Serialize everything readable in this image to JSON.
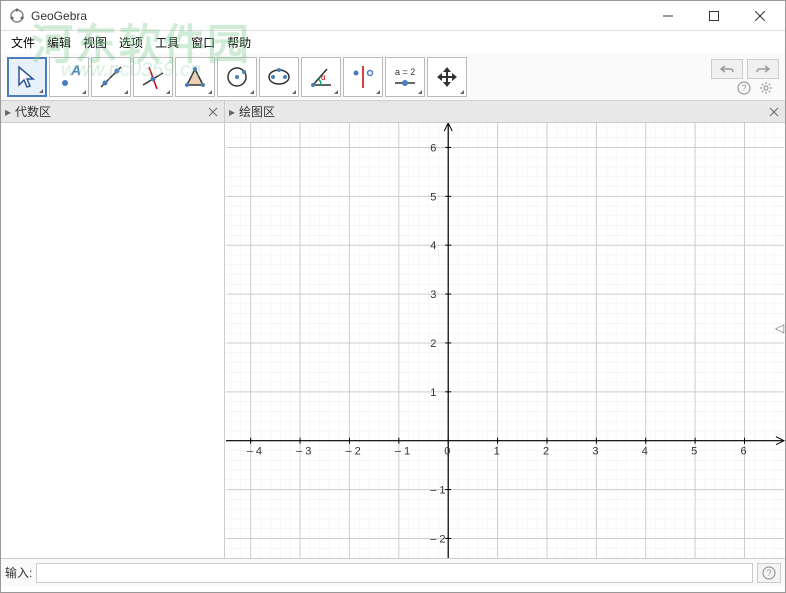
{
  "window": {
    "title": "GeoGebra",
    "min_tip": "—",
    "max_tip": "□",
    "close_tip": "✕"
  },
  "menu": {
    "items": [
      "文件",
      "编辑",
      "视图",
      "选项",
      "工具",
      "窗口",
      "帮助"
    ]
  },
  "toolbar": {
    "tools": [
      {
        "name": "move",
        "selected": true
      },
      {
        "name": "point",
        "selected": false
      },
      {
        "name": "line",
        "selected": false
      },
      {
        "name": "perpendicular",
        "selected": false
      },
      {
        "name": "polygon",
        "selected": false
      },
      {
        "name": "circle",
        "selected": false
      },
      {
        "name": "ellipse",
        "selected": false
      },
      {
        "name": "angle",
        "selected": false
      },
      {
        "name": "reflect",
        "selected": false
      },
      {
        "name": "slider",
        "selected": false
      },
      {
        "name": "move-view",
        "selected": false
      }
    ],
    "slider_text": "a = 2"
  },
  "panels": {
    "algebra": {
      "title": "代数区"
    },
    "graph": {
      "title": "绘图区"
    }
  },
  "input": {
    "label": "输入:",
    "value": "",
    "placeholder": ""
  },
  "watermark": {
    "text": "河东软件园",
    "url": "www.pc0359.cn"
  },
  "chart_data": {
    "type": "scatter",
    "title": "",
    "xlabel": "",
    "ylabel": "",
    "xlim": [
      -4.5,
      6.8
    ],
    "ylim": [
      -2.4,
      6.5
    ],
    "x_ticks": [
      -4,
      -3,
      -2,
      -1,
      0,
      1,
      2,
      3,
      4,
      5,
      6
    ],
    "y_ticks": [
      -2,
      -1,
      1,
      2,
      3,
      4,
      5,
      6
    ],
    "series": [],
    "grid": true,
    "minor_grid": true
  }
}
